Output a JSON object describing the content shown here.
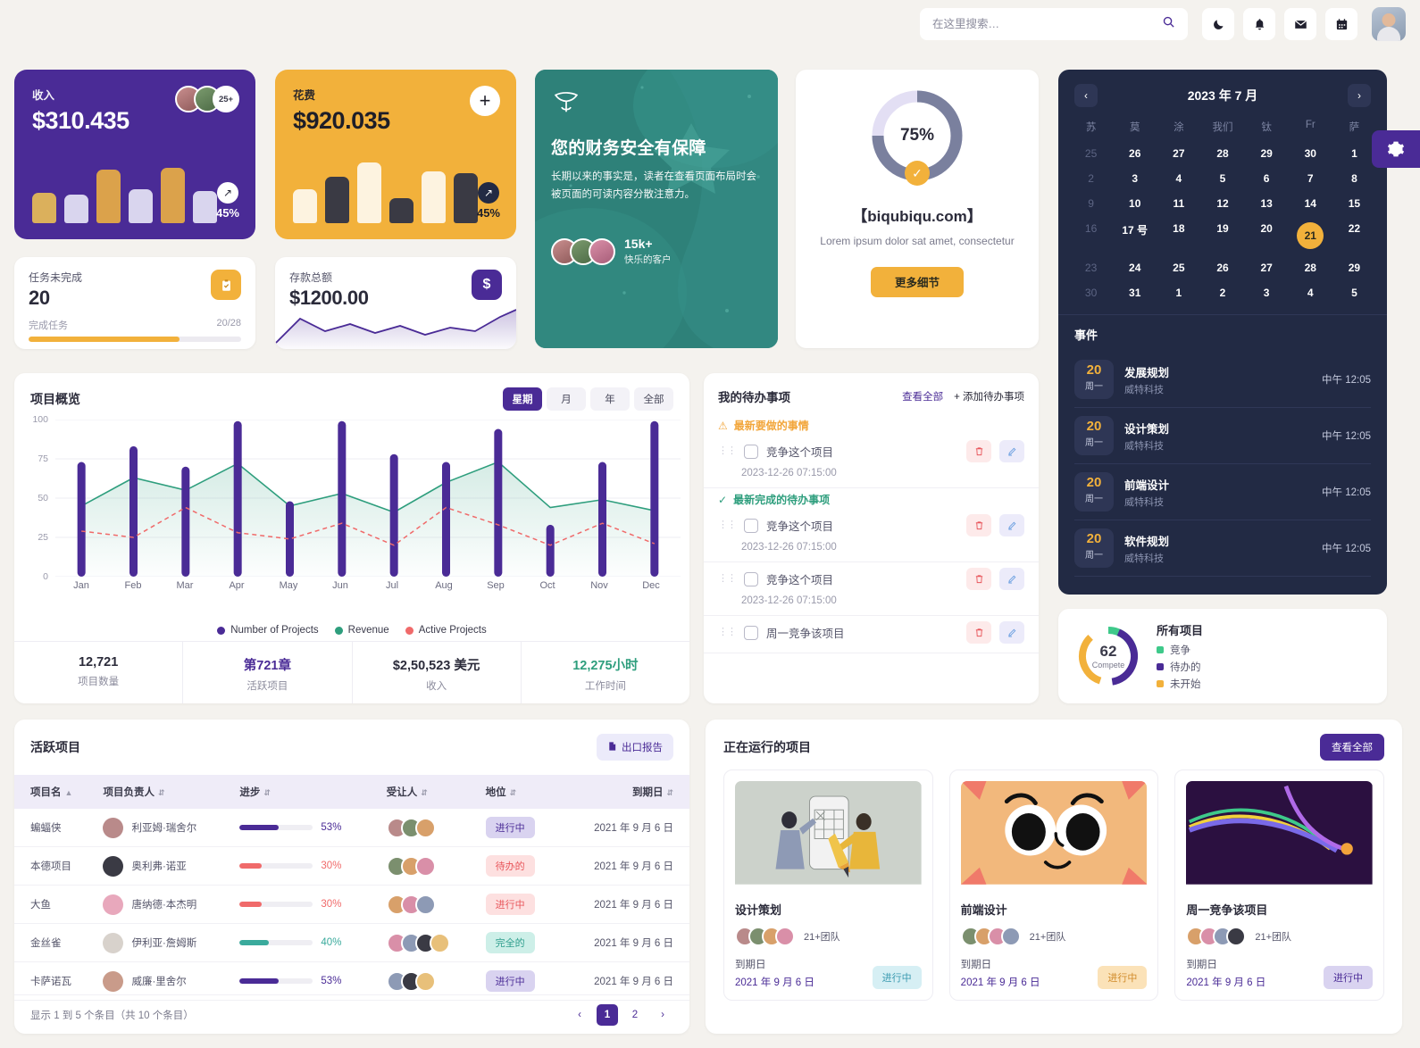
{
  "topbar": {
    "search_placeholder": "在这里搜索…",
    "search_value": "",
    "icons": [
      {
        "name": "dark-mode-icon",
        "glyph": "☽"
      },
      {
        "name": "notifications-icon",
        "glyph": "🔔"
      },
      {
        "name": "mail-icon",
        "glyph": "✉"
      },
      {
        "name": "calendar-icon",
        "glyph": "📅"
      }
    ]
  },
  "revenue": {
    "label": "收入",
    "value": "$310.435",
    "badge": "25+",
    "trend": "45%"
  },
  "expense": {
    "label": "花费",
    "value": "$920.035",
    "plus": "+",
    "trend": "45%"
  },
  "tasks": {
    "label": "任务未完成",
    "value": "20",
    "sub": "完成任务",
    "ratio": "20/28",
    "percent": 71,
    "icon": "clipboard-icon"
  },
  "deposit": {
    "label": "存款总额",
    "value": "$1200.00",
    "icon": "dollar-icon"
  },
  "promo": {
    "title": "您的财务安全有保障",
    "body": "长期以来的事实是，读者在查看页面布局时会被页面的可读内容分散注意力。",
    "count": "15k+",
    "count_label": "快乐的客户"
  },
  "progress_card": {
    "percent": "75%",
    "percent_value": 75,
    "brand": "【biqubiqu.com】",
    "subtitle": "Lorem ipsum dolor sat amet, consectetur",
    "button": "更多细节",
    "check": "✓"
  },
  "calendar": {
    "title": "2023 年 7 月",
    "prev": "‹",
    "next": "›",
    "dow": [
      "苏",
      "莫",
      "涂",
      "我们",
      "钛",
      "Fr",
      "萨"
    ],
    "weeks": [
      [
        {
          "d": "25",
          "mut": true
        },
        {
          "d": "26"
        },
        {
          "d": "27"
        },
        {
          "d": "28"
        },
        {
          "d": "29"
        },
        {
          "d": "30"
        },
        {
          "d": "1"
        }
      ],
      [
        {
          "d": "2",
          "mut": true
        },
        {
          "d": "3"
        },
        {
          "d": "4"
        },
        {
          "d": "5"
        },
        {
          "d": "6"
        },
        {
          "d": "7"
        },
        {
          "d": "8"
        }
      ],
      [
        {
          "d": "9",
          "mut": true
        },
        {
          "d": "10"
        },
        {
          "d": "11"
        },
        {
          "d": "12"
        },
        {
          "d": "13"
        },
        {
          "d": "14"
        },
        {
          "d": "15"
        }
      ],
      [
        {
          "d": "16",
          "mut": true
        },
        {
          "d": "17 号"
        },
        {
          "d": "18"
        },
        {
          "d": "19"
        },
        {
          "d": "20"
        },
        {
          "d": "21",
          "sel": true
        },
        {
          "d": "22"
        }
      ],
      [
        {
          "d": "23",
          "mut": true
        },
        {
          "d": "24"
        },
        {
          "d": "25"
        },
        {
          "d": "26"
        },
        {
          "d": "27"
        },
        {
          "d": "28"
        },
        {
          "d": "29"
        }
      ],
      [
        {
          "d": "30",
          "mut": true
        },
        {
          "d": "31"
        },
        {
          "d": "1"
        },
        {
          "d": "2"
        },
        {
          "d": "3"
        },
        {
          "d": "4"
        },
        {
          "d": "5"
        }
      ]
    ],
    "events_title": "事件",
    "events": [
      {
        "day": "20",
        "weekday": "周一",
        "name": "发展规划",
        "company": "威特科技",
        "time": "中午 12:05"
      },
      {
        "day": "20",
        "weekday": "周一",
        "name": "设计策划",
        "company": "威特科技",
        "time": "中午 12:05"
      },
      {
        "day": "20",
        "weekday": "周一",
        "name": "前端设计",
        "company": "威特科技",
        "time": "中午 12:05"
      },
      {
        "day": "20",
        "weekday": "周一",
        "name": "软件规划",
        "company": "威特科技",
        "time": "中午 12:05"
      }
    ]
  },
  "settings_gear": {
    "icon": "gear-icon",
    "glyph": "⚙"
  },
  "overview": {
    "title": "项目概览",
    "tabs": [
      {
        "label": "星期",
        "active": true
      },
      {
        "label": "月",
        "active": false
      },
      {
        "label": "年",
        "active": false
      },
      {
        "label": "全部",
        "active": false
      }
    ],
    "stats": [
      {
        "value": "12,721",
        "label": "项目数量",
        "color": "#2b2b3a"
      },
      {
        "value": "第721章",
        "label": "活跃项目",
        "color": "#4a2b96"
      },
      {
        "value": "$2,50,523 美元",
        "label": "收入",
        "color": "#2b2b3a"
      },
      {
        "value": "12,275小时",
        "label": "工作时间",
        "color": "#2e9e7d"
      }
    ]
  },
  "chart_data": {
    "type": "bar",
    "title": "项目概览",
    "categories": [
      "Jan",
      "Feb",
      "Mar",
      "Apr",
      "May",
      "Jun",
      "Jul",
      "Aug",
      "Sep",
      "Oct",
      "Nov",
      "Dec"
    ],
    "series": [
      {
        "name": "Number of Projects",
        "type": "bar",
        "color": "#4a2b96",
        "values": [
          73,
          83,
          70,
          99,
          48,
          99,
          78,
          73,
          94,
          33,
          73,
          99
        ]
      },
      {
        "name": "Revenue",
        "type": "area",
        "color": "#2e9e7d",
        "values": [
          45,
          63,
          55,
          72,
          45,
          53,
          41,
          60,
          73,
          44,
          49,
          42
        ]
      },
      {
        "name": "Active Projects",
        "type": "line-dashed",
        "color": "#f06a6a",
        "values": [
          29,
          25,
          44,
          28,
          24,
          34,
          20,
          44,
          33,
          20,
          34,
          21
        ]
      }
    ],
    "ylim": [
      0,
      100
    ],
    "yticks": [
      0,
      25,
      50,
      75,
      100
    ],
    "xlabel": "",
    "ylabel": "",
    "grid": true,
    "legend_position": "bottom"
  },
  "todo": {
    "title": "我的待办事项",
    "view_all": "查看全部",
    "add": "+ 添加待办事项",
    "section_pending": "最新要做的事情",
    "section_done": "最新完成的待办事项",
    "items": [
      {
        "text": "竞争这个项目",
        "time": "2023-12-26 07:15:00",
        "section": "pending"
      },
      {
        "text": "竞争这个项目",
        "time": "2023-12-26 07:15:00",
        "section": "done"
      },
      {
        "text": "竞争这个项目",
        "time": "2023-12-26 07:15:00",
        "section": ""
      },
      {
        "text": "周一竞争该项目",
        "time": "",
        "section": ""
      }
    ]
  },
  "all_projects": {
    "center_number": "62",
    "center_word": "Compete",
    "title": "所有项目",
    "legend": [
      {
        "label": "竞争",
        "color": "#3ec98a"
      },
      {
        "label": "待办的",
        "color": "#4a2b96"
      },
      {
        "label": "未开始",
        "color": "#f2b13b"
      }
    ]
  },
  "active_table": {
    "title": "活跃项目",
    "export": "出口报告",
    "export_icon": "export-icon",
    "columns": [
      "项目名",
      "项目负责人",
      "进步",
      "受让人",
      "地位",
      "到期日"
    ],
    "rows": [
      {
        "name": "蝙蝠侠",
        "owner": "利亚姆·瑞舍尔",
        "progress": "53%",
        "pct": 53,
        "bar": "#4a2b96",
        "status": "进行中",
        "status_bg": "#d9d3f0",
        "status_fg": "#4a2b96",
        "due": "2021 年 9 月 6 日",
        "assignees": 3,
        "ac": "#b98a8a"
      },
      {
        "name": "本德项目",
        "owner": "奥利弗·诺亚",
        "progress": "30%",
        "pct": 30,
        "bar": "#f06a6a",
        "status": "待办的",
        "status_bg": "#fde0e0",
        "status_fg": "#e8555a",
        "due": "2021 年 9 月 6 日",
        "assignees": 3,
        "ac": "#3a3a44"
      },
      {
        "name": "大鱼",
        "owner": "唐纳德·本杰明",
        "progress": "30%",
        "pct": 30,
        "bar": "#f06a6a",
        "status": "进行中",
        "status_bg": "#fde0e0",
        "status_fg": "#e8555a",
        "due": "2021 年 9 月 6 日",
        "assignees": 3,
        "ac": "#e8a8bc"
      },
      {
        "name": "金丝雀",
        "owner": "伊利亚·詹姆斯",
        "progress": "40%",
        "pct": 40,
        "bar": "#3aaa9c",
        "status": "完全的",
        "status_bg": "#cdefe8",
        "status_fg": "#2e9e8d",
        "due": "2021 年 9 月 6 日",
        "assignees": 4,
        "ac": "#d8d2cc"
      },
      {
        "name": "卡萨诺瓦",
        "owner": "威廉·里舍尔",
        "progress": "53%",
        "pct": 53,
        "bar": "#4a2b96",
        "status": "进行中",
        "status_bg": "#d9d3f0",
        "status_fg": "#4a2b96",
        "due": "2021 年 9 月 6 日",
        "assignees": 3,
        "ac": "#c99b8a"
      }
    ],
    "footer_info": "显示 1 到 5 个条目（共 10 个条目）",
    "pages": [
      "1",
      "2"
    ],
    "prev": "‹",
    "next": "›"
  },
  "running": {
    "title": "正在运行的项目",
    "view_all": "查看全部",
    "cards": [
      {
        "name": "设计策划",
        "team": "21+团队",
        "due_label": "到期日",
        "due": "2021 年 9 月 6 日",
        "status": "进行中",
        "status_bg": "#d6eff4",
        "status_fg": "#3a9ab0",
        "thumb": "design-illustration"
      },
      {
        "name": "前端设计",
        "team": "21+团队",
        "due_label": "到期日",
        "due": "2021 年 9 月 6 日",
        "status": "进行中",
        "status_bg": "#fbe2b8",
        "status_fg": "#d18b2a",
        "thumb": "cat-illustration"
      },
      {
        "name": "周一竞争该项目",
        "team": "21+团队",
        "due_label": "到期日",
        "due": "2021 年 9 月 6 日",
        "status": "进行中",
        "status_bg": "#d9d3f0",
        "status_fg": "#4a2b96",
        "thumb": "waves-illustration"
      }
    ]
  }
}
